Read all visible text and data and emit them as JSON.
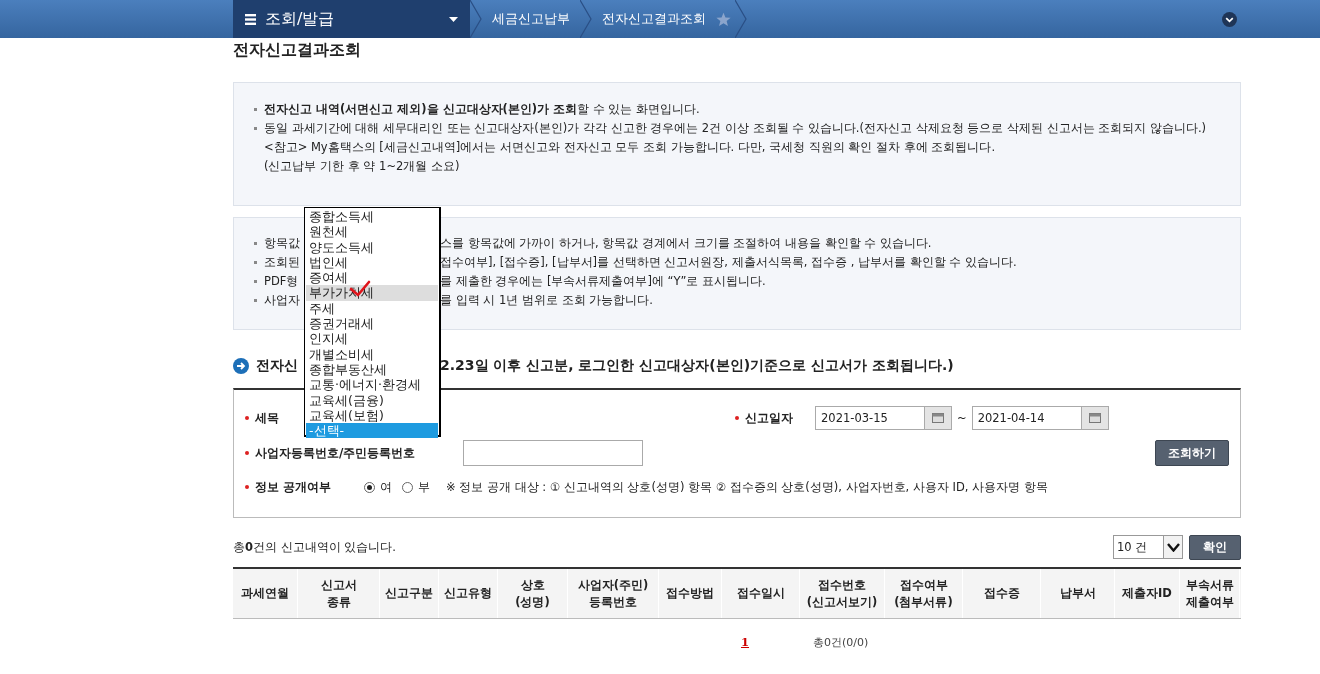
{
  "nav": {
    "menu": "조회/발급",
    "breadcrumbs": [
      "세금신고납부",
      "전자신고결과조회"
    ]
  },
  "page_title": "전자신고결과조회",
  "notice": [
    "**전자신고 내역(서면신고 제외)을 신고대상자(본인)가 조회**할 수 있는 화면입니다.",
    "동일 과세기간에 대해 세무대리인 또는 신고대상자(본인)가 각각 신고한 경우에는 2건 이상 조회될 수 있습니다.(전자신고 삭제요청 등으로 삭제된 신고서는 조회되지 않습니다.)",
    "<참고> My홈택스의 [세금신고내역]에서는 서면신고와 전자신고 모두 조회 가능합니다. 다만, 국세청 직원의 확인 절차 후에 조회됩니다.",
    "(신고납부 기한 후 약 1~2개월 소요)"
  ],
  "tips": [
    {
      "head": "항목값",
      "tail": "스를 항목값에 가까이 하거나, 항목값 경계에서 크기를 조절하여 내용을 확인할 수 있습니다."
    },
    {
      "head": "조회된",
      "tail": "접수여부], [접수증], [납부서]를 선택하면 신고서원장, 제출서식목록, 접수증 , 납부서를 확인할 수 있습니다."
    },
    {
      "head": "PDF형",
      "tail": "를 제출한 경우에는 [부속서류제출여부]에 “Y”로  표시됩니다."
    },
    {
      "head": "사업자",
      "tail": "를 입력 시 1년 범위로 조회 가능합니다."
    }
  ],
  "section": {
    "head": "전자신",
    "tail": "2.23일 이후 신고분, 로그인한  신고대상자(본인)기준으로  신고서가 조회됩니다.)"
  },
  "form": {
    "tax_label": "세목",
    "date_label": "신고일자",
    "date_from": "2021-03-15",
    "date_sep": "~",
    "date_to": "2021-04-14",
    "id_label": "사업자등록번호/주민등록번호",
    "search_button": "조회하기",
    "disclosure_label": "정보 공개여부",
    "disclosure_options": [
      {
        "label": "여",
        "selected": true
      },
      {
        "label": "부",
        "selected": false
      }
    ],
    "disclosure_note": "※ 정보 공개 대상 : ① 신고내역의 상호(성명) 항목 ② 접수증의 상호(성명), 사업자번호, 사용자 ID, 사용자명 항목"
  },
  "dropdown": [
    {
      "label": "종합소득세",
      "selected": false,
      "hovered": false
    },
    {
      "label": "원천세",
      "selected": false,
      "hovered": false
    },
    {
      "label": "양도소득세",
      "selected": false,
      "hovered": false
    },
    {
      "label": "법인세",
      "selected": false,
      "hovered": false
    },
    {
      "label": "증여세",
      "selected": false,
      "hovered": false
    },
    {
      "label": "부가가치세",
      "selected": false,
      "hovered": true
    },
    {
      "label": "주세",
      "selected": false,
      "hovered": false
    },
    {
      "label": "증권거래세",
      "selected": false,
      "hovered": false
    },
    {
      "label": "인지세",
      "selected": false,
      "hovered": false
    },
    {
      "label": "개별소비세",
      "selected": false,
      "hovered": false
    },
    {
      "label": "종합부동산세",
      "selected": false,
      "hovered": false
    },
    {
      "label": "교통·에너지·환경세",
      "selected": false,
      "hovered": false
    },
    {
      "label": "교육세(금융)",
      "selected": false,
      "hovered": false
    },
    {
      "label": "교육세(보험)",
      "selected": false,
      "hovered": false
    },
    {
      "label": "-선택-",
      "selected": true,
      "hovered": false
    }
  ],
  "results": {
    "count_text": "총**0**건의 신고내역이 있습니다.",
    "page_size": "10 건",
    "confirm_button": "확인"
  },
  "table": {
    "columns": [
      [
        "과세연월"
      ],
      [
        "신고서",
        "종류"
      ],
      [
        "신고구분"
      ],
      [
        "신고유형"
      ],
      [
        "상호",
        "(성명)"
      ],
      [
        "사업자(주민)",
        "등록번호"
      ],
      [
        "접수방법"
      ],
      [
        "접수일시"
      ],
      [
        "접수번호",
        "(신고서보기)"
      ],
      [
        "접수여부",
        "(첨부서류)"
      ],
      [
        "접수증"
      ],
      [
        "납부서"
      ],
      [
        "제출자ID"
      ],
      [
        "부속서류",
        "제출여부"
      ]
    ]
  },
  "pagination": {
    "pages": [
      {
        "label": "1",
        "selected": true
      }
    ],
    "total": "총0건(0/0)"
  }
}
